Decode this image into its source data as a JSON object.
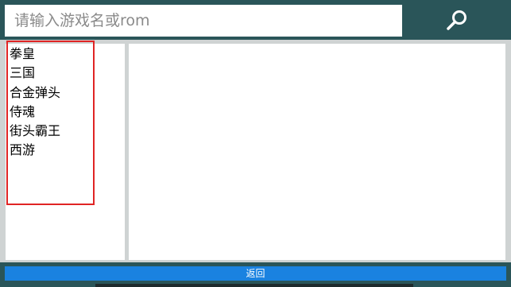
{
  "search": {
    "placeholder": "请输入游戏名或rom",
    "icon": "search-icon"
  },
  "categories": [
    "拳皇",
    "三国",
    "合金弹头",
    "侍魂",
    "街头霸王",
    "西游"
  ],
  "footer": {
    "back_label": "返回"
  },
  "colors": {
    "header": "#2a5559",
    "back_button": "#1a82e0",
    "highlight_border": "#e02424"
  }
}
